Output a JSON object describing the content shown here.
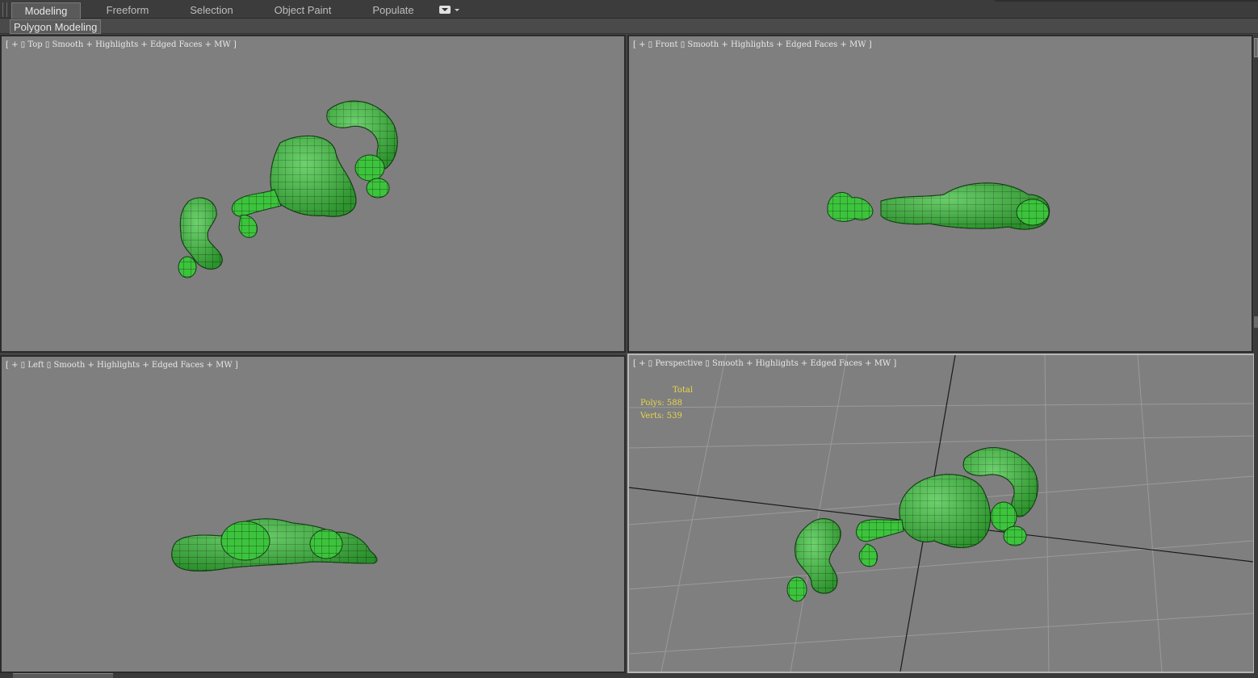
{
  "ribbon": {
    "tabs": [
      {
        "label": "Modeling",
        "active": true
      },
      {
        "label": "Freeform",
        "active": false
      },
      {
        "label": "Selection",
        "active": false
      },
      {
        "label": "Object Paint",
        "active": false
      },
      {
        "label": "Populate",
        "active": false
      }
    ],
    "panel_label": "Polygon Modeling",
    "options_icon": "dropdown-menu-icon"
  },
  "viewports": {
    "top": {
      "label": "[ + ▯ Top ▯ Smooth + Highlights + Edged Faces + MW ]"
    },
    "front": {
      "label": "[ + ▯ Front ▯ Smooth + Highlights + Edged Faces + MW ]"
    },
    "left": {
      "label": "[ + ▯ Left ▯ Smooth + Highlights + Edged Faces + MW ]"
    },
    "perspective": {
      "label": "[ + ▯ Perspective ▯ Smooth + Highlights + Edged Faces + MW ]",
      "stats": {
        "header": "Total",
        "polys_label": "Polys:",
        "polys": "588",
        "verts_label": "Verts:",
        "verts": "539"
      }
    }
  },
  "colors": {
    "viewport_bg": "#7f7f7f",
    "mesh_fill": "#3cc43c",
    "mesh_edge": "#153d15",
    "stats_text": "#e8d84a",
    "label_text": "#e8e8e8"
  }
}
